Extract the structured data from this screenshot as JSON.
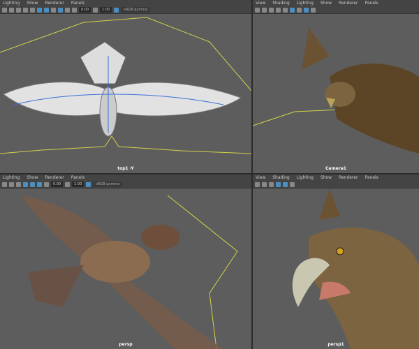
{
  "menus_left": [
    "Lighting",
    "Show",
    "Renderer",
    "Panels"
  ],
  "menus_right": [
    "View",
    "Shading",
    "Lighting",
    "Show",
    "Renderer",
    "Panels"
  ],
  "toolbar": {
    "exposure": "0.00",
    "gamma": "1.00",
    "color_space": "sRGB gamma"
  },
  "panes": [
    {
      "camera": "top1 -Y"
    },
    {
      "camera": "Camera1"
    },
    {
      "camera": "persp"
    },
    {
      "camera": "persp1"
    }
  ],
  "colors": {
    "viewport_bg": "#5d5d5d",
    "toolbar_bg": "#444444",
    "accent": "#4a8fbf",
    "curve": "#d4d24a"
  }
}
